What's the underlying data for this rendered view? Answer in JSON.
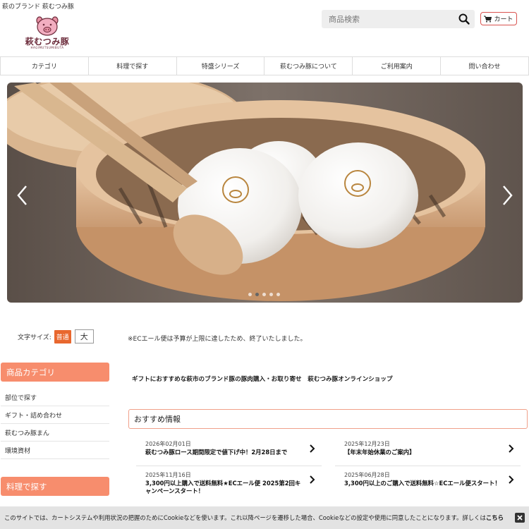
{
  "header": {
    "tagline": "萩のブランド 萩むつみ豚",
    "logo_text": "萩むつみ豚",
    "logo_sub": "HAGIMUTSUMIBUTA"
  },
  "search": {
    "placeholder": "商品検索",
    "icon": "search-icon"
  },
  "cart": {
    "label": "カート",
    "icon": "cart-icon"
  },
  "gnav": [
    "カテゴリ",
    "料理で探す",
    "特盛シリーズ",
    "萩むつみ豚について",
    "ご利用案内",
    "問い合わせ"
  ],
  "slider": {
    "slides": 5,
    "active_index": 2
  },
  "font_size": {
    "label": "文字サイズ:",
    "normal": "普通",
    "large": "大"
  },
  "notice": "※ECエール便は予算が上限に達したため、終了いたしました。",
  "lead": "ギフトにおすすめな萩市のブランド豚の豚肉購入・お取り寄せ　萩むつみ豚オンラインショップ",
  "sidebar": {
    "category_head": "商品カテゴリ",
    "items": [
      "部位で探す",
      "ギフト・詰め合わせ",
      "萩むつみ豚まん",
      "環境資材"
    ],
    "cooking_head": "料理で探す"
  },
  "recommend": {
    "heading": "おすすめ情報",
    "news": [
      {
        "date": "2026年02月01日",
        "title": "萩むつみ豚ロース期間限定で値下げ中！2月28日まで"
      },
      {
        "date": "2025年12月23日",
        "title": "【年末年始休業のご案内】"
      },
      {
        "date": "2025年11月16日",
        "title": "3,300円以上購入で送料無料★ECエール便 2025第2回キャンペーンスタート！"
      },
      {
        "date": "2025年06月28日",
        "title": "3,300円以上のご購入で送料無料☆ECエール便スタート！"
      }
    ]
  },
  "cookie": {
    "text": "このサイトでは、カートシステムや利用状況の把握のためにCookieなどを使います。これ以降ページを遷移した場合、Cookieなどの設定や使用に同意したことになります。詳しくは",
    "link": "こちら"
  },
  "colors": {
    "accent": "#f78d6d",
    "brand": "#6b2a3a",
    "font_active": "#e8672e"
  }
}
